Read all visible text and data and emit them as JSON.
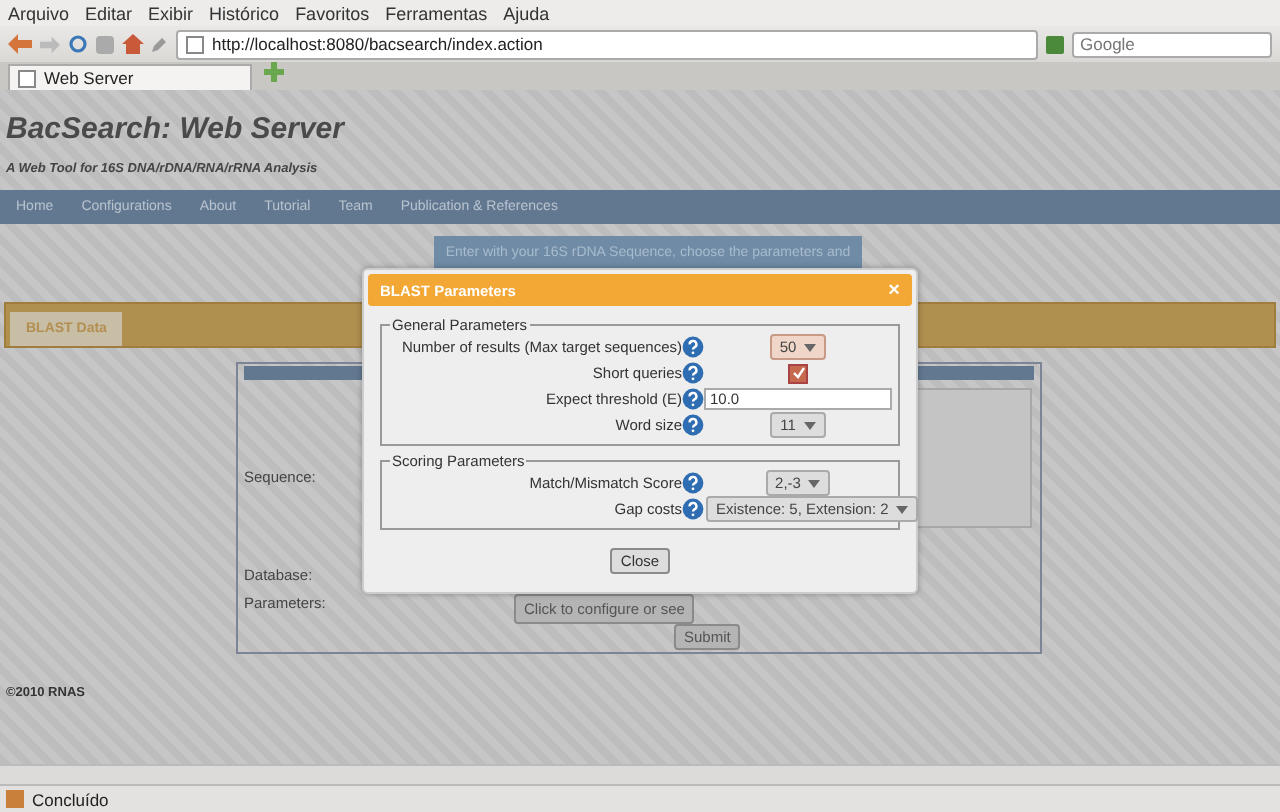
{
  "browser": {
    "menu": [
      "Arquivo",
      "Editar",
      "Exibir",
      "Histórico",
      "Favoritos",
      "Ferramentas",
      "Ajuda"
    ],
    "url": "http://localhost:8080/bacsearch/index.action",
    "search_placeholder": "Google",
    "tab_title": "Web Server",
    "status": "Concluído"
  },
  "site": {
    "title": "BacSearch: Web Server",
    "subtitle": "A Web Tool for 16S DNA/rDNA/RNA/rRNA Analysis",
    "nav": [
      "Home",
      "Configurations",
      "About",
      "Tutorial",
      "Team",
      "Publication & References"
    ],
    "banner": "Enter with your 16S rDNA Sequence, choose the parameters and",
    "section_tab": "BLAST Data",
    "form": {
      "labels": [
        "Sequence:",
        "Database:",
        "Parameters:"
      ],
      "configure_button": "Click to configure or see",
      "submit_button": "Submit"
    },
    "footer": "©2010 RNAS"
  },
  "dialog": {
    "title": "BLAST Parameters",
    "close_symbol": "×",
    "groups": [
      {
        "legend": "General Parameters",
        "rows": [
          {
            "kind": "select",
            "label": "Number of results (Max target sequences)",
            "value": "50",
            "focused": true
          },
          {
            "kind": "checkbox",
            "label": "Short queries",
            "checked": true
          },
          {
            "kind": "text",
            "label": "Expect threshold (E)",
            "value": "10.0"
          },
          {
            "kind": "select",
            "label": "Word size",
            "value": "11",
            "focused": false
          }
        ]
      },
      {
        "legend": "Scoring Parameters",
        "rows": [
          {
            "kind": "select",
            "label": "Match/Mismatch Score",
            "value": "2,-3",
            "focused": false
          },
          {
            "kind": "select",
            "label": "Gap costs",
            "value": "Existence: 5, Extension: 2",
            "focused": false
          }
        ]
      }
    ],
    "close_button": "Close"
  }
}
